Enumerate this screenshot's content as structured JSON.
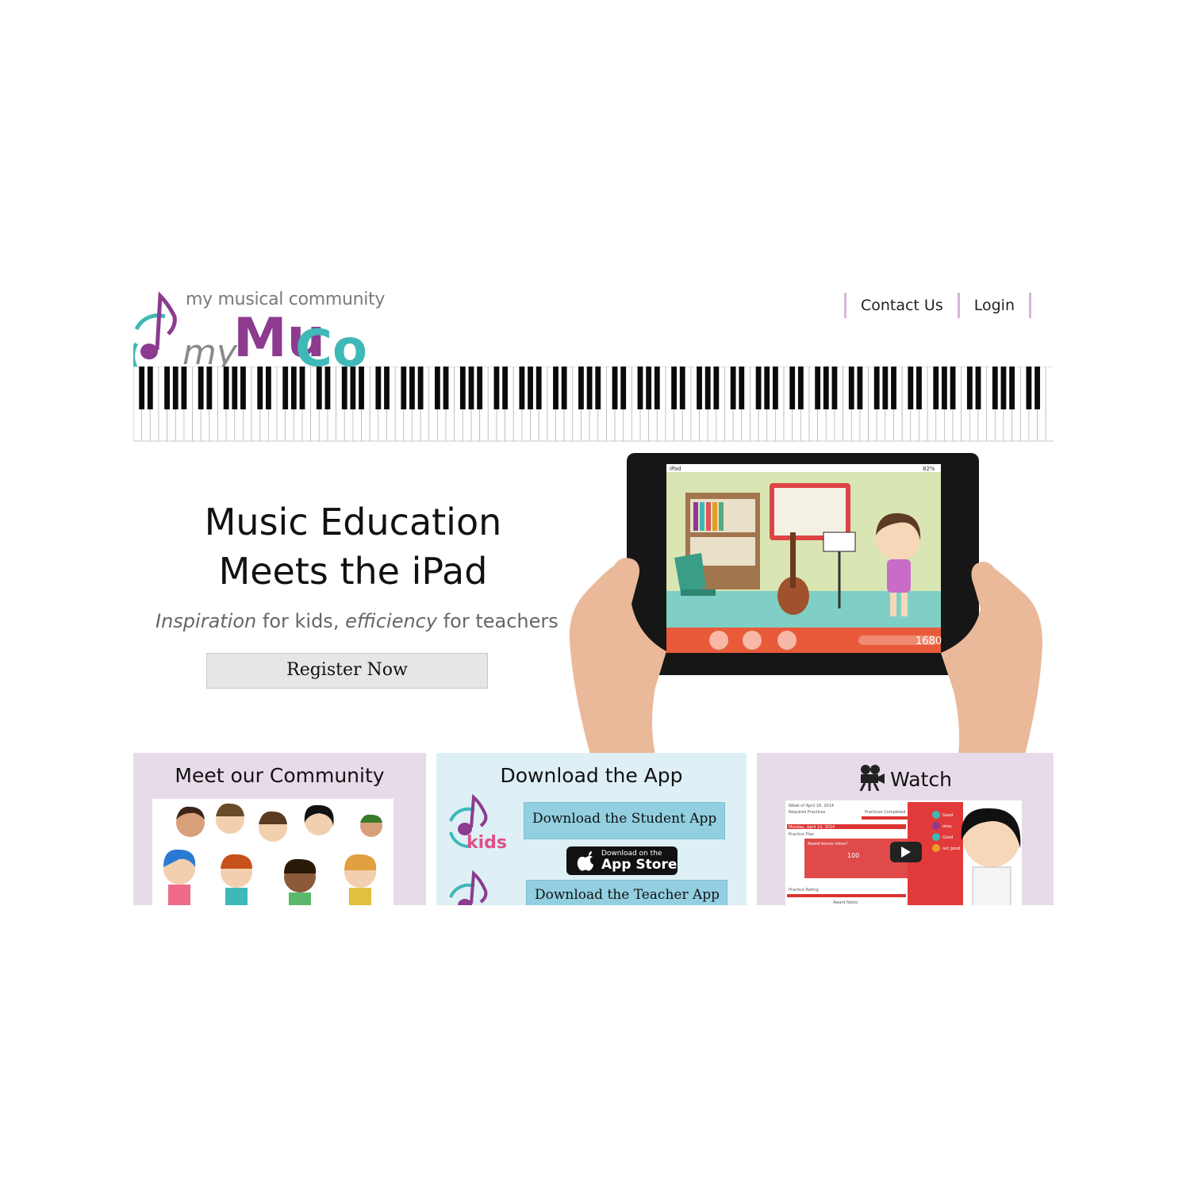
{
  "brand": {
    "tagline": "my musical community",
    "name_my": "my",
    "name_mu": "Mu",
    "name_co": "Co",
    "colors": {
      "purple": "#8c3b8f",
      "teal": "#3fb8b8",
      "lavender": "#e8dbe9",
      "lightblue": "#def0f5"
    }
  },
  "nav": {
    "items": [
      "Contact Us",
      "Login"
    ]
  },
  "hero": {
    "title_line1": "Music Education",
    "title_line2": "Meets the iPad",
    "sub_word1": "Inspiration",
    "sub_mid": " for kids, ",
    "sub_word2": "efficiency",
    "sub_end": " for teachers",
    "register_label": "Register Now",
    "ipad_score": "1680",
    "ipad_status": "iPad",
    "ipad_battery": "82%"
  },
  "panels": {
    "community": {
      "title": "Meet our Community"
    },
    "download": {
      "title": "Download the App",
      "student_btn": "Download the Student App",
      "teacher_btn": "Download the Teacher App",
      "kids_label": "kids",
      "appstore_small": "Download on the",
      "appstore_big": "App Store"
    },
    "watch": {
      "title": "Watch",
      "video_lines": [
        "Week of April 18, 2014",
        "Required Practices",
        "Practices Completed",
        "Monday, April 14, 2014",
        "Practice Plan",
        "Award bonus notes?",
        "100",
        "Practice Rating",
        "Award Notes"
      ],
      "ratings": [
        "Good",
        "okay",
        "Good",
        "not good"
      ]
    }
  }
}
